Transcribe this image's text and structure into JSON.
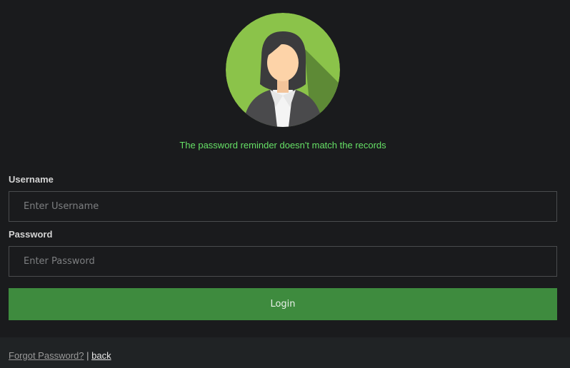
{
  "avatar": {
    "icon": "user-avatar-icon",
    "bg_color": "#8bc34a"
  },
  "message": {
    "text": "The password reminder doesn't match the records",
    "color": "#66e066"
  },
  "form": {
    "username_label": "Username",
    "username_placeholder": "Enter Username",
    "username_value": "",
    "password_label": "Password",
    "password_placeholder": "Enter Password",
    "password_value": "",
    "login_label": "Login",
    "login_color": "#3e8b3e"
  },
  "footer": {
    "forgot_label": "Forgot Password?",
    "separator": " | ",
    "back_label": "back"
  }
}
